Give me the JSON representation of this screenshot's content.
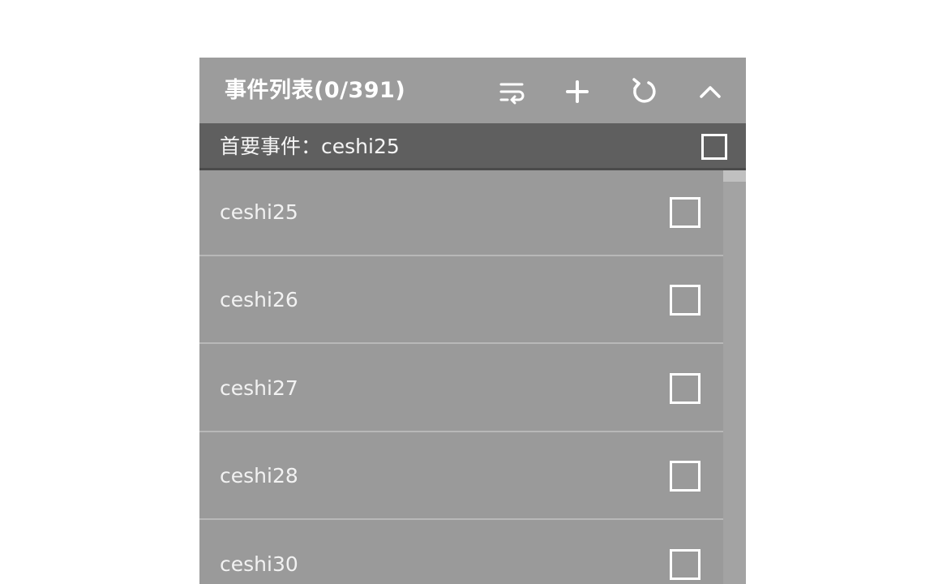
{
  "header": {
    "title": "事件列表(0/391)",
    "icons": [
      "wrap-text-icon",
      "plus-icon",
      "refresh-icon",
      "chevron-up-icon"
    ]
  },
  "primary": {
    "label": "首要事件：ceshi25",
    "checked": false
  },
  "list": {
    "items": [
      {
        "label": "ceshi25",
        "checked": false
      },
      {
        "label": "ceshi26",
        "checked": false
      },
      {
        "label": "ceshi27",
        "checked": false
      },
      {
        "label": "ceshi28",
        "checked": false
      },
      {
        "label": "ceshi30",
        "checked": false
      }
    ]
  },
  "colors": {
    "header_bg": "#9c9c9c",
    "primary_bg": "#5f5f5f",
    "list_bg": "#9a9a9a",
    "text": "#ffffff"
  }
}
